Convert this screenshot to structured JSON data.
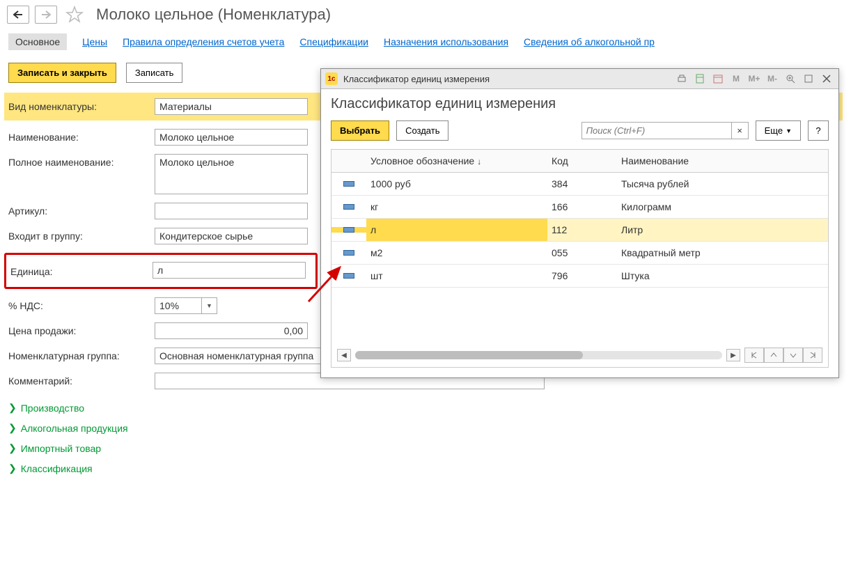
{
  "header": {
    "title": "Молоко цельное (Номенклатура)"
  },
  "tabs": {
    "main": "Основное",
    "prices": "Цены",
    "accounts": "Правила определения счетов учета",
    "specs": "Спецификации",
    "usage": "Назначения использования",
    "alcohol": "Сведения об алкогольной пр"
  },
  "toolbar": {
    "save_close": "Записать и закрыть",
    "save": "Записать"
  },
  "form": {
    "kind_label": "Вид номенклатуры:",
    "kind_value": "Материалы",
    "name_label": "Наименование:",
    "name_value": "Молоко цельное",
    "fullname_label": "Полное наименование:",
    "fullname_value": "Молоко цельное",
    "art_label": "Артикул:",
    "art_value": "",
    "group_label": "Входит в группу:",
    "group_value": "Кондитерское сырье",
    "unit_label": "Единица:",
    "unit_value": "л",
    "vat_label": "% НДС:",
    "vat_value": "10%",
    "price_label": "Цена продажи:",
    "price_value": "0,00",
    "nomgroup_label": "Номенклатурная группа:",
    "nomgroup_value": "Основная номенклатурная группа",
    "comment_label": "Комментарий:",
    "comment_value": ""
  },
  "collapsibles": {
    "a": "Производство",
    "b": "Алкогольная продукция",
    "c": "Импортный товар",
    "d": "Классификация"
  },
  "dialog": {
    "window_title": "Классификатор единиц измерения",
    "heading": "Классификатор единиц измерения",
    "select_btn": "Выбрать",
    "create_btn": "Создать",
    "search_placeholder": "Поиск (Ctrl+F)",
    "more_btn": "Еще",
    "help_btn": "?",
    "cols": {
      "c1": "Условное обозначение",
      "c2": "Код",
      "c3": "Наименование"
    },
    "rows": [
      {
        "short": "1000 руб",
        "code": "384",
        "name": "Тысяча рублей",
        "selected": false
      },
      {
        "short": "кг",
        "code": "166",
        "name": "Килограмм",
        "selected": false
      },
      {
        "short": "л",
        "code": "112",
        "name": "Литр",
        "selected": true
      },
      {
        "short": "м2",
        "code": "055",
        "name": "Квадратный метр",
        "selected": false
      },
      {
        "short": "шт",
        "code": "796",
        "name": "Штука",
        "selected": false
      }
    ],
    "tool_m": "M",
    "tool_mp": "M+",
    "tool_mm": "M-"
  }
}
